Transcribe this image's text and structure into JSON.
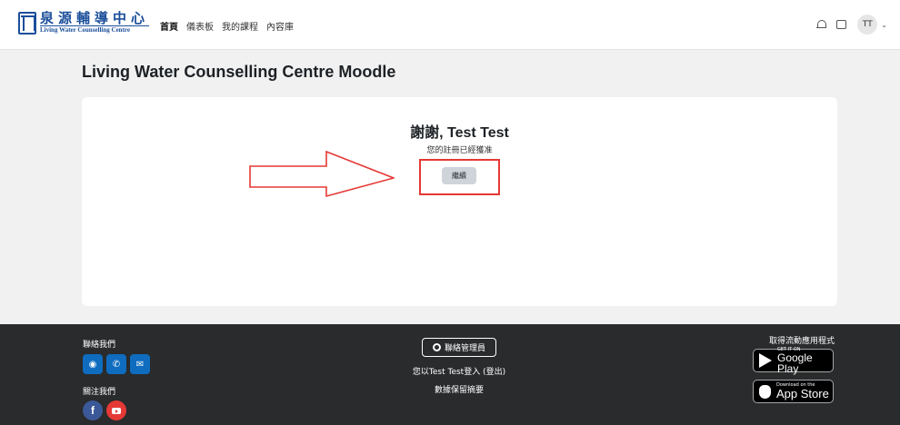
{
  "brand": {
    "name_zh": "泉源輔導中心",
    "name_en": "Living Water Counselling Centre"
  },
  "nav": {
    "links": [
      "首頁",
      "儀表板",
      "我的課程",
      "內容庫"
    ],
    "active_index": 0
  },
  "user": {
    "initials": "TT"
  },
  "page": {
    "title": "Living Water Counselling Centre Moodle"
  },
  "confirmation": {
    "heading": "謝謝, Test Test",
    "message": "您的註冊已經獲准",
    "continue_label": "繼續"
  },
  "footer": {
    "contact_title": "聯絡我們",
    "follow_title": "關注我們",
    "contact_admin_label": "聯絡管理員",
    "logged_in_prefix": "您以",
    "logged_in_user": "Test Test",
    "logged_in_suffix": "登入 (",
    "logout_label": "登出",
    "logged_in_end": ")",
    "data_retention": "數據保留摘要",
    "get_app": "取得流動應用程式",
    "google_play": {
      "small": "GET IT ON",
      "big": "Google Play"
    },
    "app_store": {
      "small": "Download on the",
      "big": "App Store"
    }
  },
  "annotation": {
    "color": "#e53935"
  }
}
